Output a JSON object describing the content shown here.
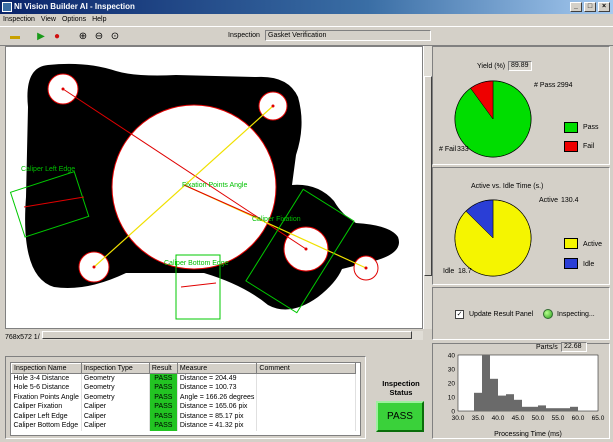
{
  "window": {
    "title": "NI Vision Builder AI - Inspection"
  },
  "menu": [
    "Inspection",
    "View",
    "Options",
    "Help"
  ],
  "toolbar": {
    "inspection_label": "Inspection",
    "inspection_value": "Gasket Verification"
  },
  "image": {
    "size_label": "768x572 1/1",
    "annotations": {
      "caliper_left": "Caliper Left Edge",
      "fixation_angle": "Fixation Points Angle",
      "caliper_fixation": "Caliper Fixation",
      "caliper_bottom": "Caliper Bottom Edge"
    }
  },
  "yield": {
    "label": "Yield (%)",
    "value": "89.89",
    "pass_label": "# Pass",
    "pass_count": "2994",
    "fail_label": "# Fail",
    "fail_count": "333",
    "legend_pass": "Pass",
    "legend_fail": "Fail",
    "pass_fraction": 0.8999,
    "pass_color": "#00dd00",
    "fail_color": "#ee0000"
  },
  "active_idle": {
    "title": "Active vs. Idle Time (s.)",
    "active_label": "Active",
    "active_value": "130.4",
    "idle_label": "Idle",
    "idle_value": "18.7",
    "legend_active": "Active",
    "legend_idle": "Idle",
    "active_color": "#f5f500",
    "idle_color": "#2a3ed6"
  },
  "controls": {
    "update_label": "Update Result Panel",
    "inspecting_label": "Inspecting...",
    "parts_label": "Parts/s",
    "parts_value": "22.68"
  },
  "results": {
    "headers": [
      "Inspection Name",
      "Inspection Type",
      "Result",
      "Measure",
      "Comment"
    ],
    "rows": [
      [
        "Hole 3-4 Distance",
        "Geometry",
        "PASS",
        "Distance = 204.49",
        ""
      ],
      [
        "Hole 5-6 Distance",
        "Geometry",
        "PASS",
        "Distance = 100.73",
        ""
      ],
      [
        "Fixation Points Angle",
        "Geometry",
        "PASS",
        "Angle = 166.26 degrees",
        ""
      ],
      [
        "Caliper Fixation",
        "Caliper",
        "PASS",
        "Distance = 165.06 pix",
        ""
      ],
      [
        "Caliper Left Edge",
        "Caliper",
        "PASS",
        "Distance = 85.17 pix",
        ""
      ],
      [
        "Caliper Bottom Edge",
        "Caliper",
        "PASS",
        "Distance = 41.32 pix",
        ""
      ]
    ]
  },
  "status": {
    "title": "Inspection Status",
    "result": "PASS"
  },
  "chart_data": {
    "type": "bar",
    "xlabel": "Processing Time (ms)",
    "xlim": [
      30,
      65
    ],
    "ylim": [
      0,
      40
    ],
    "x_ticks": [
      "30.0",
      "35.0",
      "40.0",
      "45.0",
      "50.0",
      "55.0",
      "60.0",
      "65.0"
    ],
    "y_ticks": [
      "0",
      "10",
      "20",
      "30",
      "40"
    ],
    "bin_start": 34,
    "bin_width": 2,
    "values": [
      13,
      40,
      23,
      11,
      12,
      8,
      3,
      3,
      4,
      2,
      2,
      2,
      3
    ]
  }
}
